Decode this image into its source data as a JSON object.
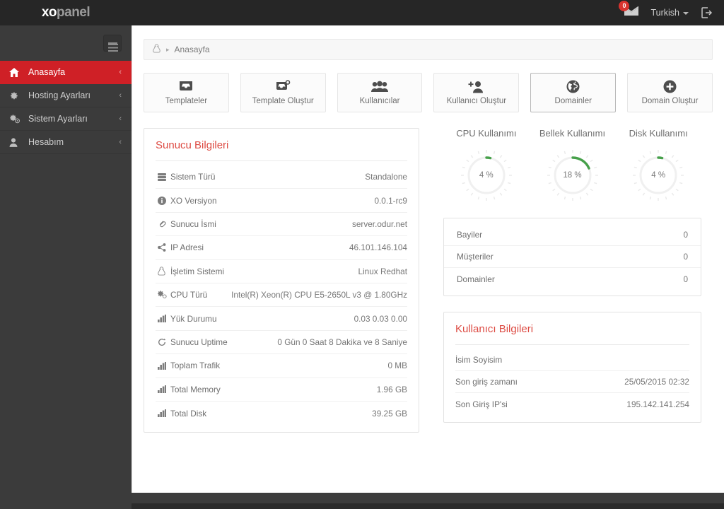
{
  "topbar": {
    "brand_prefix": "xo",
    "brand_suffix": "panel",
    "mail_badge": "0",
    "mail_icon": "envelope-icon",
    "language": "Turkish",
    "logout_icon": "logout-icon"
  },
  "sidebar": {
    "toggle_icon": "hamburger-menu-icon",
    "items": [
      {
        "label": "Anasayfa",
        "icon": "home-icon",
        "chevron": "‹",
        "active": true
      },
      {
        "label": "Hosting Ayarları",
        "icon": "gear-icon",
        "chevron": "‹",
        "active": false
      },
      {
        "label": "Sistem Ayarları",
        "icon": "gears-icon",
        "chevron": "‹",
        "active": false
      },
      {
        "label": "Hesabım",
        "icon": "user-icon",
        "chevron": "‹",
        "active": false
      }
    ]
  },
  "breadcrumb": {
    "icon": "linux-tux-icon",
    "separator": "▸",
    "text": "Anasayfa"
  },
  "quick_actions": [
    {
      "label": "Templateler",
      "icon": "inbox-icon",
      "hovered": false
    },
    {
      "label": "Template Oluştur",
      "icon": "inbox-plus-icon",
      "hovered": false
    },
    {
      "label": "Kullanıcılar",
      "icon": "users-icon",
      "hovered": false
    },
    {
      "label": "Kullanıcı Oluştur",
      "icon": "user-plus-icon",
      "hovered": false
    },
    {
      "label": "Domainler",
      "icon": "globe-icon",
      "hovered": true
    },
    {
      "label": "Domain Oluştur",
      "icon": "plus-circle-icon",
      "hovered": false
    }
  ],
  "server_panel": {
    "title": "Sunucu Bilgileri",
    "rows": [
      {
        "icon": "server-icon",
        "label": "Sistem Türü",
        "value": "Standalone"
      },
      {
        "icon": "info-circle-icon",
        "label": "XO Versiyon",
        "value": "0.0.1-rc9"
      },
      {
        "icon": "link-icon",
        "label": "Sunucu İsmi",
        "value": "server.odur.net"
      },
      {
        "icon": "share-icon",
        "label": "IP Adresi",
        "value": "46.101.146.104"
      },
      {
        "icon": "linux-tux-icon",
        "label": "İşletim Sistemi",
        "value": "Linux Redhat"
      },
      {
        "icon": "gears-icon",
        "label": "CPU Türü",
        "value": "Intel(R) Xeon(R) CPU E5-2650L v3 @ 1.80GHz"
      },
      {
        "icon": "bar-chart-icon",
        "label": "Yük Durumu",
        "value": "0.03 0.03 0.00"
      },
      {
        "icon": "refresh-icon",
        "label": "Sunucu Uptime",
        "value": "0 Gün 0 Saat 8 Dakika ve 8 Saniye"
      },
      {
        "icon": "bar-chart-icon",
        "label": "Toplam Trafik",
        "value": "0 MB"
      },
      {
        "icon": "bar-chart-icon",
        "label": "Total Memory",
        "value": "1.96 GB"
      },
      {
        "icon": "bar-chart-icon",
        "label": "Total Disk",
        "value": "39.25 GB"
      }
    ]
  },
  "gauges": [
    {
      "title": "CPU Kullanımı",
      "value": "4 %",
      "percent": 4,
      "color": "#4aa css"
    },
    {
      "title": "Bellek Kullanımı",
      "value": "18 %",
      "percent": 18,
      "color": "#46a04a"
    },
    {
      "title": "Disk Kullanımı",
      "value": "4 %",
      "percent": 4,
      "color": "#46a04a"
    }
  ],
  "stats_panel": {
    "rows": [
      {
        "label": "Bayiler",
        "value": "0"
      },
      {
        "label": "Müşteriler",
        "value": "0"
      },
      {
        "label": "Domainler",
        "value": "0"
      }
    ]
  },
  "user_panel": {
    "title": "Kullanıcı Bilgileri",
    "rows": [
      {
        "label": "İsim Soyisim",
        "value": ""
      },
      {
        "label": "Son giriş zamanı",
        "value": "25/05/2015 02:32"
      },
      {
        "label": "Son Giriş IP'si",
        "value": "195.142.141.254"
      }
    ]
  },
  "theme": {
    "accent_red": "#cf2026",
    "title_red": "#dd4b43",
    "gauge_green": "#46a04a",
    "sidebar_bg": "#3b3b3b",
    "topbar_bg": "#262626"
  }
}
